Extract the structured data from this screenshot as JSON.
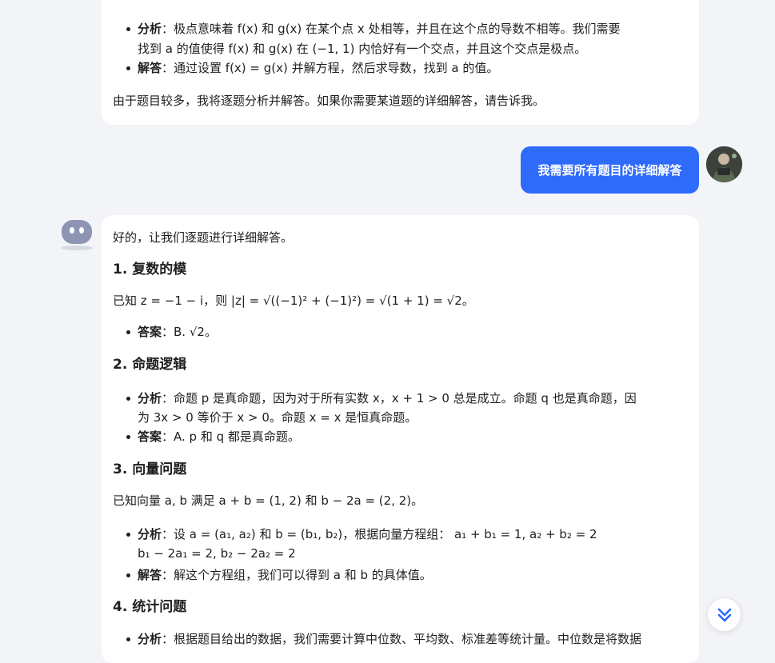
{
  "card1": {
    "analysis_label": "分析",
    "analysis_text_1": "：极点意味着 f(x) 和 g(x) 在某个点 x 处相等，并且在这个点的导数不相等。我们需要",
    "analysis_text_2": "找到 a 的值使得 f(x) 和 g(x) 在 (−1, 1) 内恰好有一个交点，并且这个交点是极点。",
    "solution_label": "解答",
    "solution_text": "：通过设置 f(x) = g(x) 并解方程，然后求导数，找到 a 的值。",
    "note": "由于题目较多，我将逐题分析并解答。如果你需要某道题的详细解答，请告诉我。"
  },
  "user_message": "我需要所有题目的详细解答",
  "card2": {
    "intro": "好的，让我们逐题进行详细解答。",
    "h1": "1. 复数的模",
    "p1": "已知 z = −1 − i，则 |z| = √((−1)² + (−1)²) = √(1 + 1) = √2。",
    "ans1_label": "答案",
    "ans1_text": "：B. √2。",
    "h2": "2. 命题逻辑",
    "an2_label": "分析",
    "an2_text_1": "：命题 p 是真命题，因为对于所有实数 x，x + 1 > 0 总是成立。命题 q 也是真命题，因",
    "an2_text_2": "为 3x > 0 等价于 x > 0。命题 x = x 是恒真命题。",
    "ans2_label": "答案",
    "ans2_text": "：A. p 和 q 都是真命题。",
    "h3": "3. 向量问题",
    "p3": "已知向量 a, b 满足 a + b = (1, 2) 和 b − 2a = (2, 2)。",
    "an3_label": "分析",
    "an3_text_1": "：设 a = (a₁, a₂) 和 b = (b₁, b₂)，根据向量方程组： a₁ + b₁ = 1,   a₂ + b₂ = 2",
    "an3_text_2": "b₁ − 2a₁ = 2,   b₂ − 2a₂ = 2",
    "ans3_label": "解答",
    "ans3_text": "：解这个方程组，我们可以得到 a 和 b 的具体值。",
    "h4": "4. 统计问题",
    "an4_label": "分析",
    "an4_text": "：根据题目给出的数据，我们需要计算中位数、平均数、标准差等统计量。中位数是将数据"
  },
  "colors": {
    "accent": "#2f6bfb",
    "background": "#f3f4f8",
    "card": "#ffffff"
  }
}
